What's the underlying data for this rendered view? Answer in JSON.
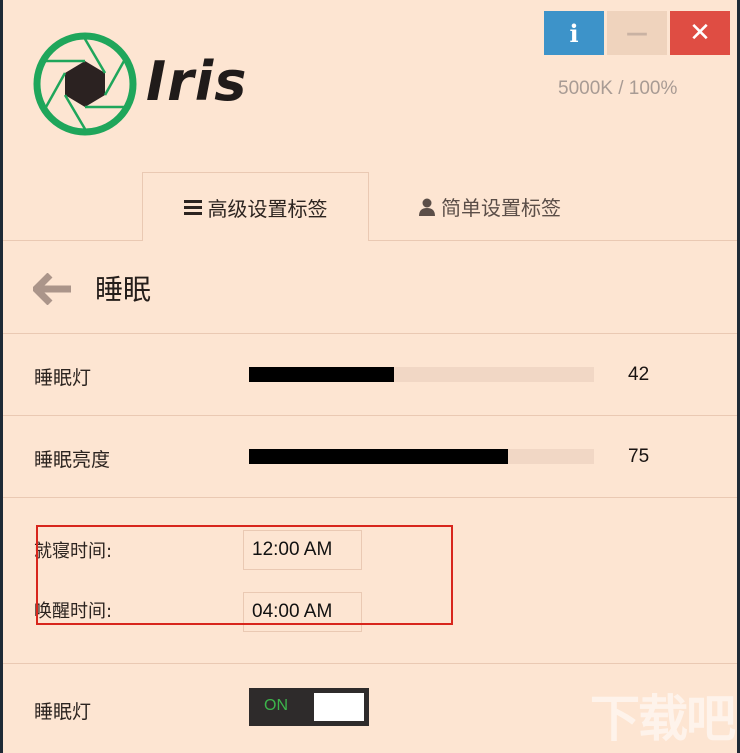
{
  "window": {
    "buttons": {
      "info_label": "i",
      "minimize_label": "—",
      "close_label": "✕"
    }
  },
  "brand": {
    "name": "Iris",
    "status": "5000K / 100%"
  },
  "tabs": [
    {
      "label": "高级设置标签",
      "icon": "menu-icon",
      "active": true
    },
    {
      "label": "简单设置标签",
      "icon": "user-icon",
      "active": false
    }
  ],
  "section": {
    "title": "睡眠"
  },
  "sliders": [
    {
      "label": "睡眠灯",
      "value": "42",
      "fraction": 0.42
    },
    {
      "label": "睡眠亮度",
      "value": "75",
      "fraction": 0.75
    }
  ],
  "times": {
    "bed": {
      "label": "就寝时间:",
      "value": "12:00 AM"
    },
    "wake": {
      "label": "唤醒时间:",
      "value": "04:00 AM"
    }
  },
  "toggle": {
    "label": "睡眠灯",
    "state": "ON"
  },
  "watermark": "下载吧",
  "colors": {
    "background": "#fde5d2",
    "info_button": "#3d93c9",
    "close_button": "#df4d43",
    "logo_green": "#1fa65b",
    "slider_fill": "#000000",
    "toggle_on_text": "#3cb44b",
    "highlight_border": "#d8261c"
  }
}
